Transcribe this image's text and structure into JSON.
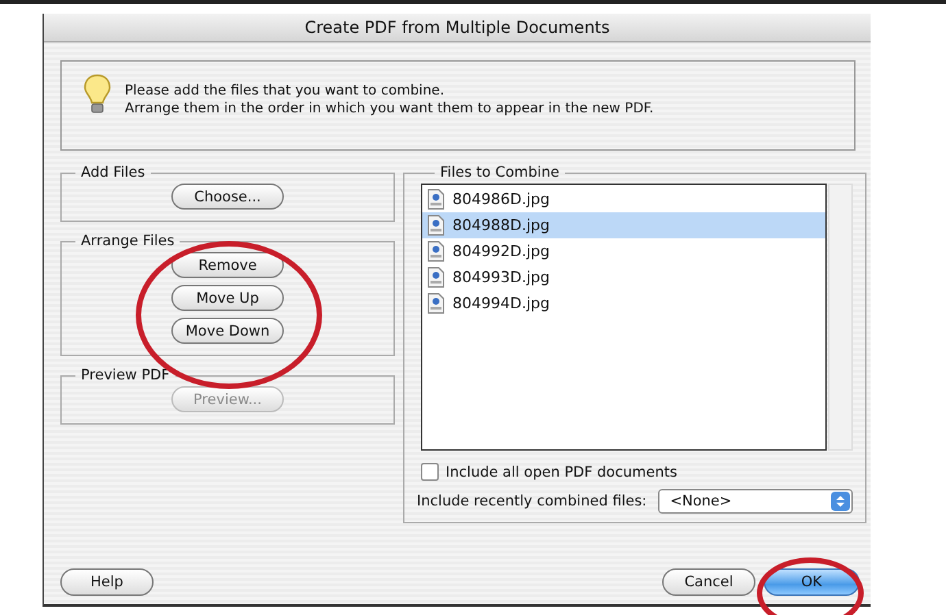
{
  "window": {
    "title": "Create PDF from Multiple Documents"
  },
  "info": {
    "lines": [
      "Please add the files that you want to combine.",
      "Arrange them in the order in which you want them to appear in the new PDF."
    ]
  },
  "add_files": {
    "title": "Add Files",
    "buttons": [
      {
        "label": "Choose...",
        "disabled": false
      }
    ]
  },
  "arrange_files": {
    "title": "Arrange Files",
    "buttons": [
      {
        "label": "Remove",
        "disabled": false
      },
      {
        "label": "Move Up",
        "disabled": false
      },
      {
        "label": "Move Down",
        "disabled": false
      }
    ]
  },
  "preview_pdf": {
    "title": "Preview PDF",
    "buttons": [
      {
        "label": "Preview...",
        "disabled": true
      }
    ]
  },
  "files_to_combine": {
    "title": "Files to Combine",
    "files": [
      {
        "name": "804986D.jpg",
        "selected": false
      },
      {
        "name": "804988D.jpg",
        "selected": true
      },
      {
        "name": "804992D.jpg",
        "selected": false
      },
      {
        "name": "804993D.jpg",
        "selected": false
      },
      {
        "name": "804994D.jpg",
        "selected": false
      }
    ],
    "include_open": {
      "label": "Include all open PDF documents",
      "checked": false
    },
    "recent": {
      "label": "Include recently combined files:",
      "value": "<None>"
    }
  },
  "buttons": [
    {
      "label": "Help",
      "kind": "plain"
    },
    {
      "label": "Cancel",
      "kind": "plain"
    },
    {
      "label": "OK",
      "kind": "default"
    }
  ],
  "annotations": [
    {
      "kind": "ellipse"
    },
    {
      "kind": "ellipse"
    }
  ]
}
